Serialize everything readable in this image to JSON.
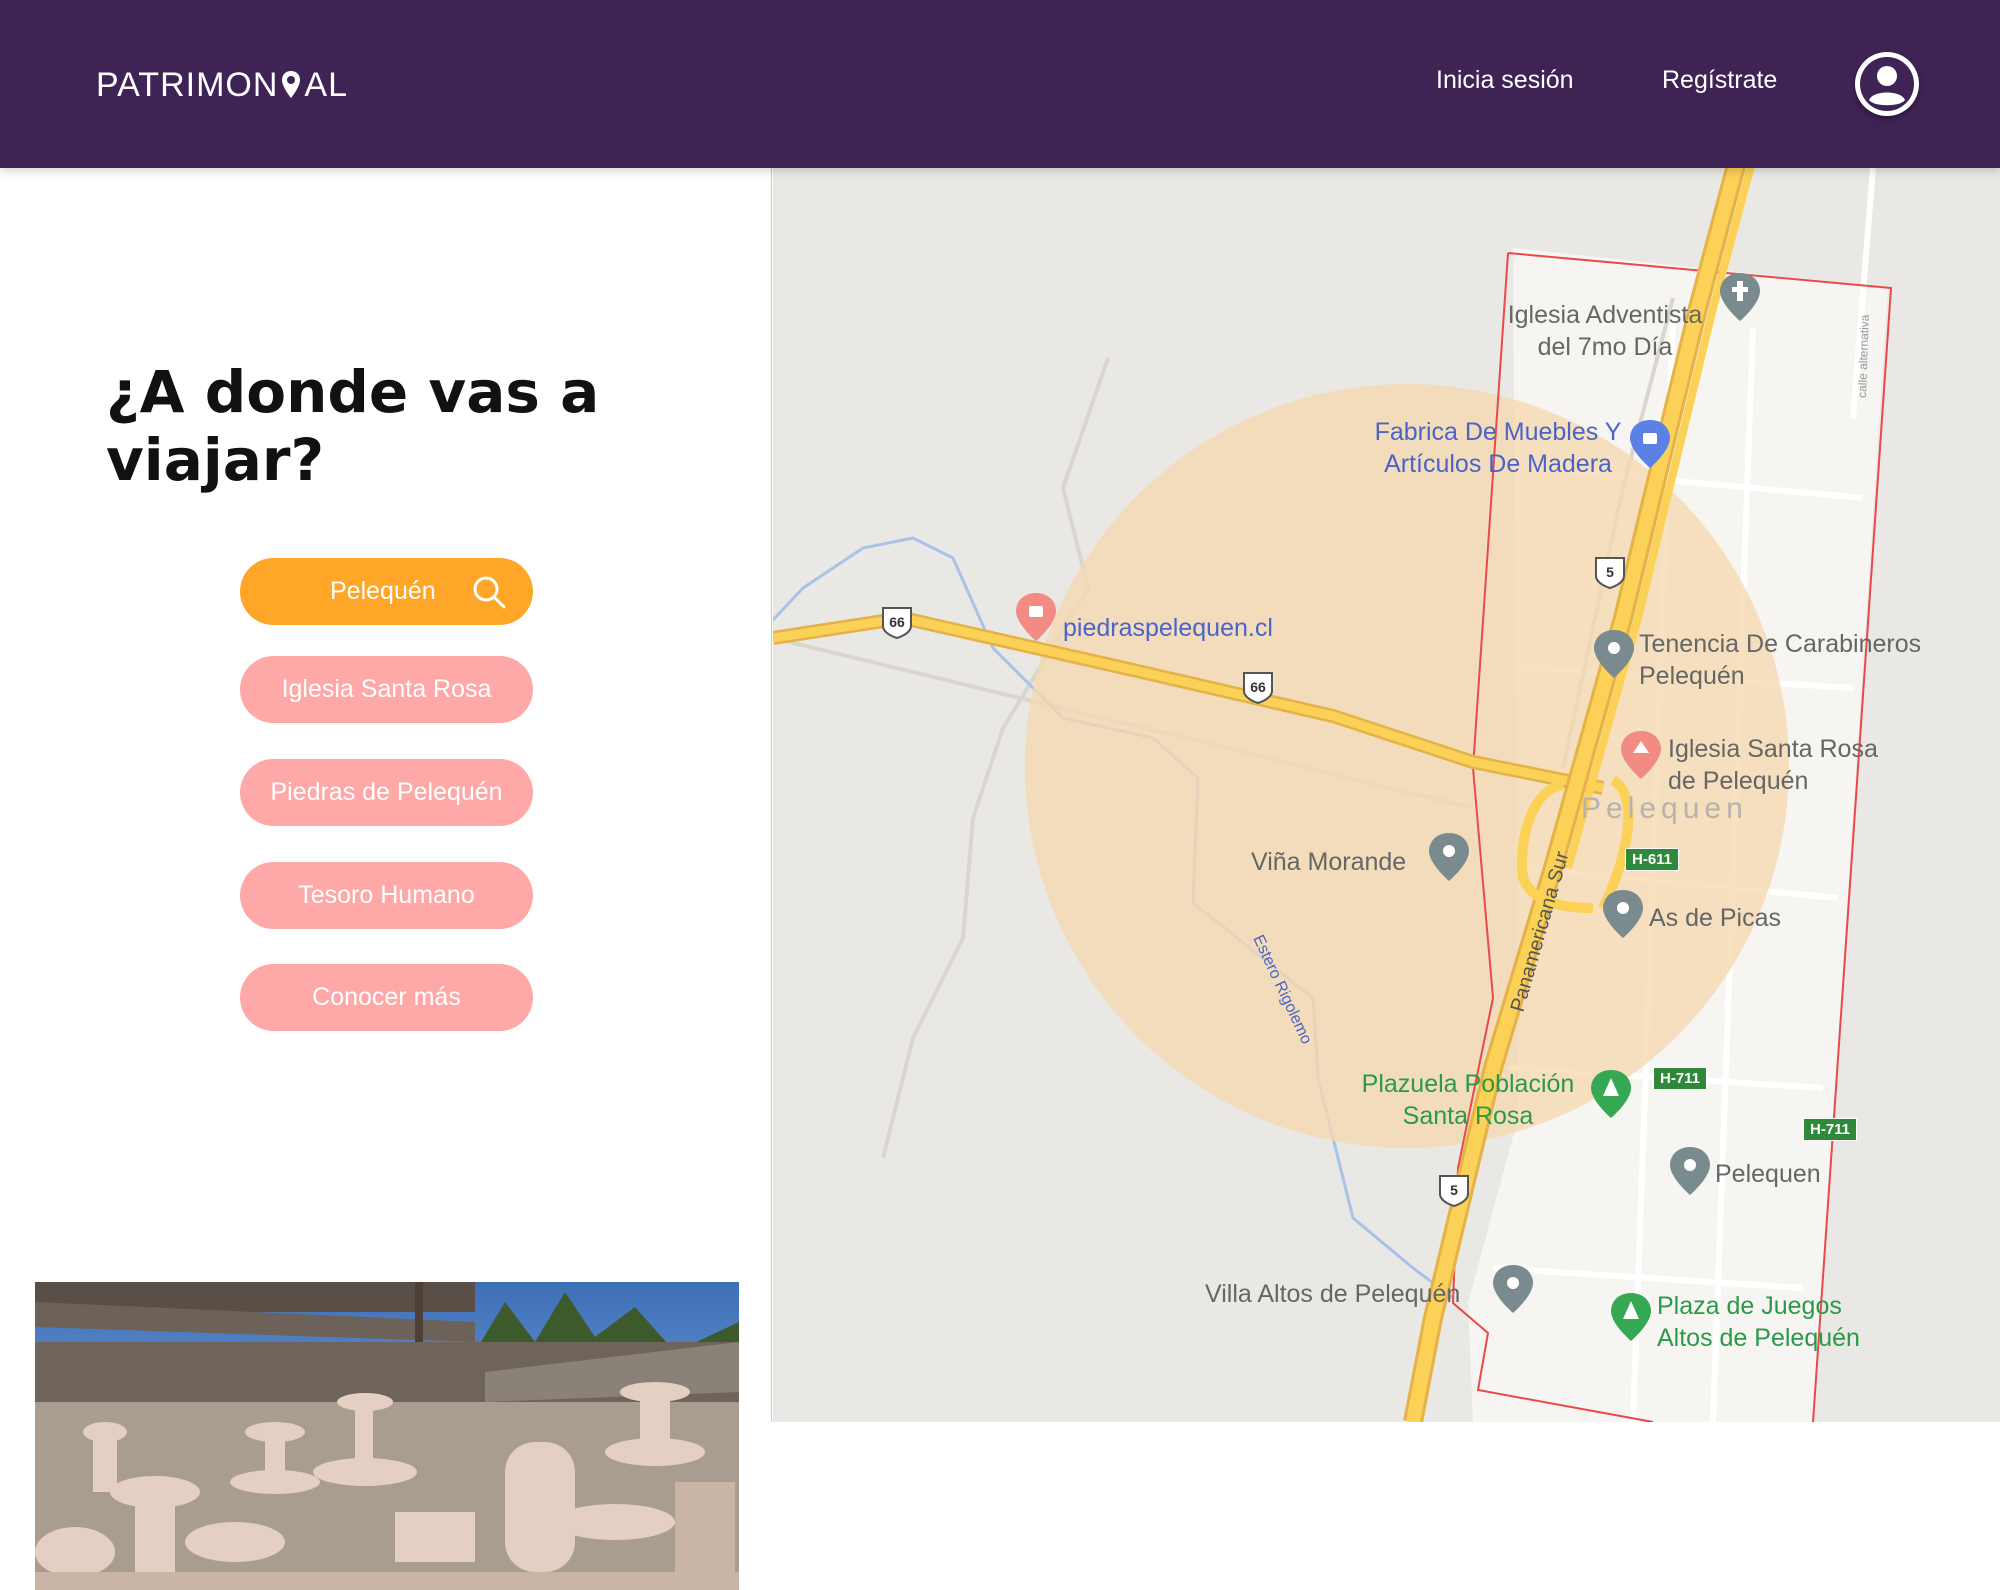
{
  "header": {
    "logo_text_start": "PATRIMON",
    "logo_text_end": "AL",
    "login_label": "Inicia sesión",
    "register_label": "Regístrate",
    "brand_bg": "#3f2355"
  },
  "sidebar": {
    "title": "¿A donde vas a viajar?",
    "search": {
      "value": "Pelequén",
      "color": "#ffa628"
    },
    "suggestions": [
      {
        "label": "Iglesia Santa Rosa"
      },
      {
        "label": "Piedras de Pelequén"
      },
      {
        "label": "Tesoro Humano"
      },
      {
        "label": "Conocer más"
      }
    ],
    "pill_color": "#ffa8a8"
  },
  "map": {
    "town_label": "Pelequen",
    "road_labels": [
      "Panamericana Sur",
      "Estero Rigolemo"
    ],
    "route_shields": [
      "66",
      "66",
      "5",
      "5"
    ],
    "highway_badges": [
      "H-611",
      "H-711",
      "H-711"
    ],
    "street_label": "calle alternativa",
    "places": [
      {
        "name": "Iglesia Adventista del 7mo Día",
        "icon": "church-icon"
      },
      {
        "name": "Fabrica De Muebles Y Artículos De Madera",
        "icon": "shopping-bag-icon"
      },
      {
        "name": "piedraspelequen.cl",
        "icon": "shopping-bag-icon"
      },
      {
        "name": "Tenencia De Carabineros Pelequén",
        "icon": "police-icon"
      },
      {
        "name": "Iglesia Santa Rosa de Pelequén",
        "icon": "church-icon"
      },
      {
        "name": "Viña Morande",
        "icon": "pin-icon"
      },
      {
        "name": "As de Picas",
        "icon": "pin-icon"
      },
      {
        "name": "Plazuela Población Santa Rosa",
        "icon": "tree-icon"
      },
      {
        "name": "Pelequen",
        "icon": "pin-icon"
      },
      {
        "name": "Villa Altos de Pelequén",
        "icon": "pin-icon"
      },
      {
        "name": "Plaza de Juegos Altos de Pelequén",
        "icon": "tree-icon"
      }
    ],
    "colors": {
      "highlight": "#f5d9b0",
      "road": "#f8c443",
      "boundary": "#e84a4a"
    }
  }
}
